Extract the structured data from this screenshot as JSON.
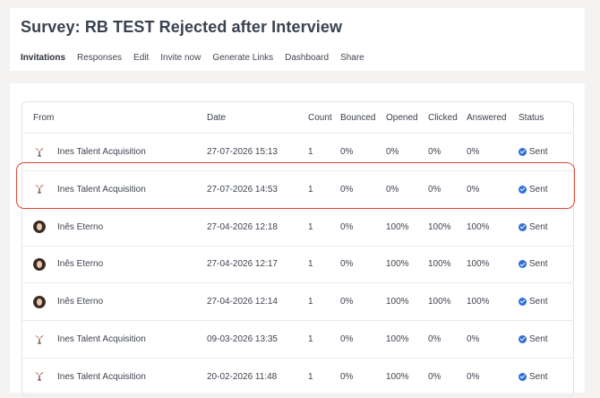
{
  "header": {
    "title": "Survey: RB TEST Rejected after Interview",
    "tabs": [
      {
        "label": "Invitations",
        "active": true
      },
      {
        "label": "Responses"
      },
      {
        "label": "Edit"
      },
      {
        "label": "Invite now"
      },
      {
        "label": "Generate Links"
      },
      {
        "label": "Dashboard"
      },
      {
        "label": "Share"
      }
    ]
  },
  "table": {
    "columns": {
      "from": "From",
      "date": "Date",
      "count": "Count",
      "bounced": "Bounced",
      "opened": "Opened",
      "clicked": "Clicked",
      "answered": "Answered",
      "status": "Status"
    },
    "rows": [
      {
        "avatar": "logo",
        "from": "Ines Talent Acquisition",
        "date": "27-07-2026 15:13",
        "count": "1",
        "bounced": "0%",
        "opened": "0%",
        "clicked": "0%",
        "answered": "0%",
        "status": "Sent"
      },
      {
        "avatar": "logo",
        "from": "Ines Talent Acquisition",
        "date": "27-07-2026 14:53",
        "count": "1",
        "bounced": "0%",
        "opened": "0%",
        "clicked": "0%",
        "answered": "0%",
        "status": "Sent"
      },
      {
        "avatar": "person",
        "from": "Inês Eterno",
        "date": "27-04-2026 12:18",
        "count": "1",
        "bounced": "0%",
        "opened": "100%",
        "clicked": "100%",
        "answered": "100%",
        "status": "Sent"
      },
      {
        "avatar": "person",
        "from": "Inês Eterno",
        "date": "27-04-2026 12:17",
        "count": "1",
        "bounced": "0%",
        "opened": "100%",
        "clicked": "100%",
        "answered": "100%",
        "status": "Sent"
      },
      {
        "avatar": "person",
        "from": "Inês Eterno",
        "date": "27-04-2026 12:14",
        "count": "1",
        "bounced": "0%",
        "opened": "100%",
        "clicked": "100%",
        "answered": "100%",
        "status": "Sent"
      },
      {
        "avatar": "logo",
        "from": "Ines Talent Acquisition",
        "date": "09-03-2026 13:35",
        "count": "1",
        "bounced": "0%",
        "opened": "100%",
        "clicked": "0%",
        "answered": "0%",
        "status": "Sent"
      },
      {
        "avatar": "logo",
        "from": "Ines Talent Acquisition",
        "date": "20-02-2026 11:48",
        "count": "1",
        "bounced": "0%",
        "opened": "100%",
        "clicked": "0%",
        "answered": "0%",
        "status": "Sent"
      }
    ]
  },
  "colors": {
    "highlight": "#e0463a",
    "status_icon": "#2f6fd6"
  }
}
